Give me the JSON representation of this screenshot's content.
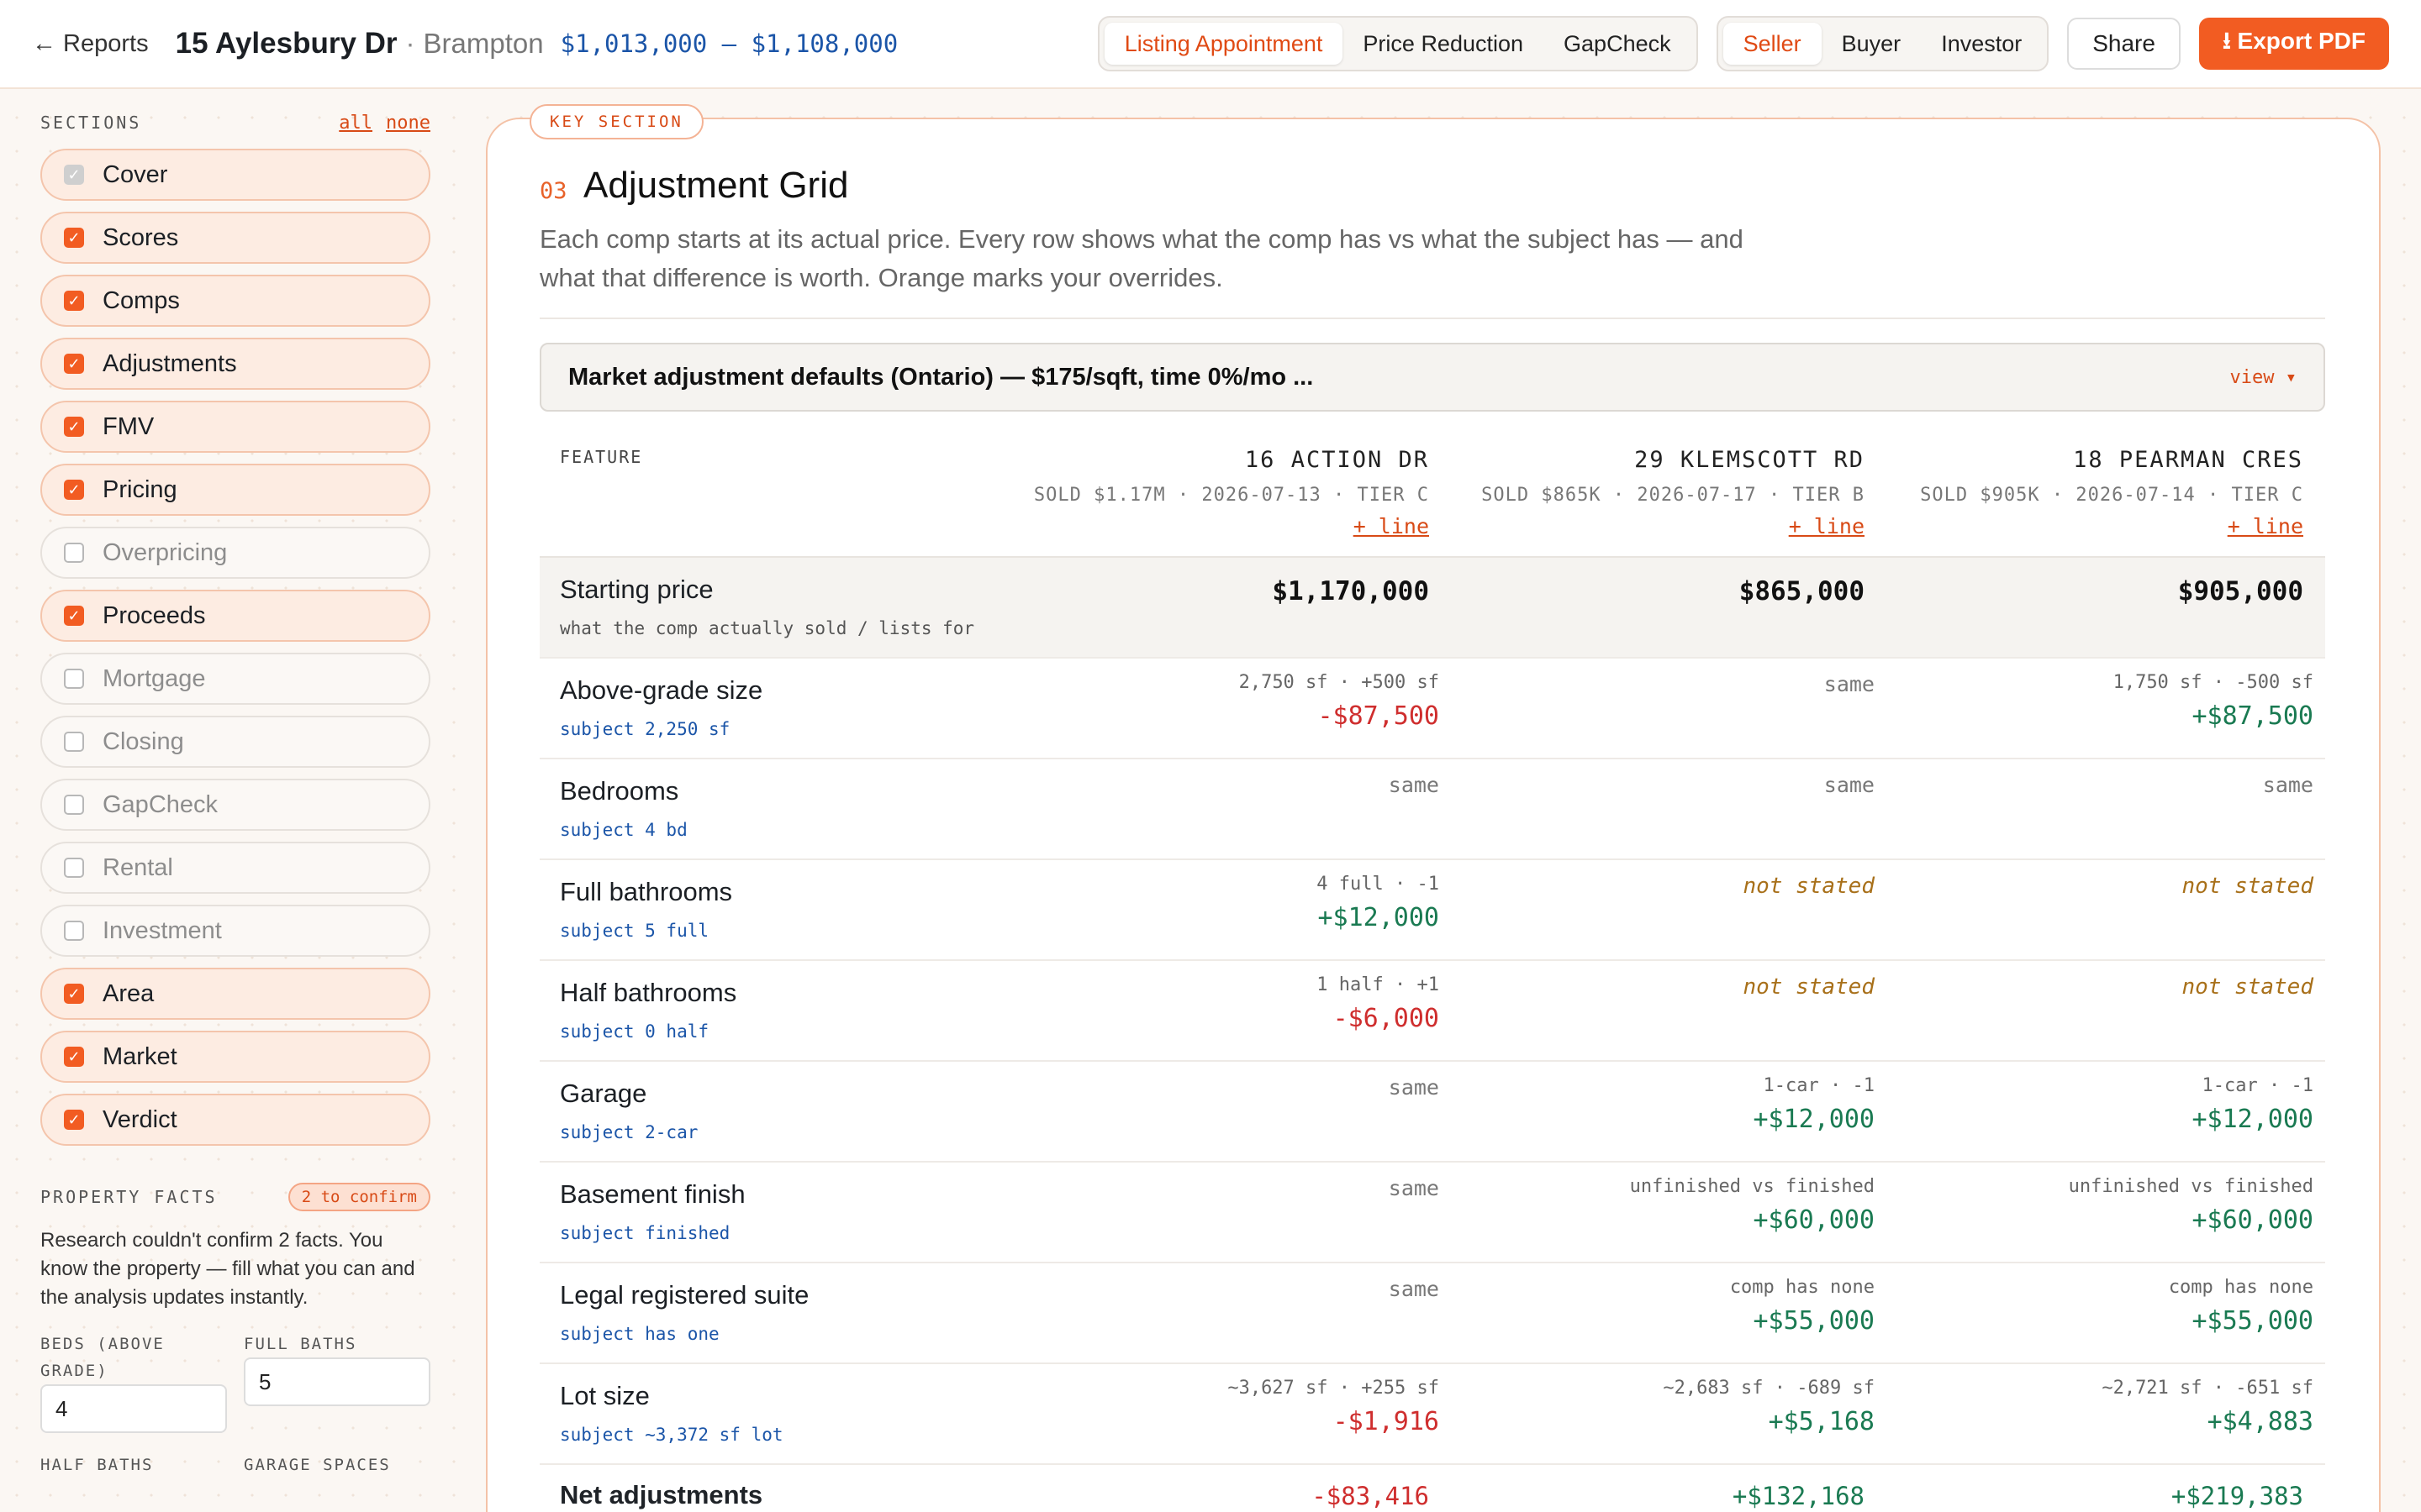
{
  "header": {
    "back_label": "← Reports",
    "address": "15 Aylesbury Dr",
    "separator": "·",
    "city": "Brampton",
    "price_range": "$1,013,000 – $1,108,000",
    "report_types": [
      "Listing Appointment",
      "Price Reduction",
      "GapCheck"
    ],
    "audiences": [
      "Seller",
      "Buyer",
      "Investor"
    ],
    "share_label": "Share",
    "export_label": "⭳ Export PDF"
  },
  "sidebar": {
    "sections_caption": "SECTIONS",
    "all_label": "all",
    "none_label": "none",
    "sections": [
      {
        "label": "Cover",
        "state": "locked"
      },
      {
        "label": "Scores",
        "state": "on"
      },
      {
        "label": "Comps",
        "state": "on"
      },
      {
        "label": "Adjustments",
        "state": "on"
      },
      {
        "label": "FMV",
        "state": "on"
      },
      {
        "label": "Pricing",
        "state": "on"
      },
      {
        "label": "Overpricing",
        "state": "off"
      },
      {
        "label": "Proceeds",
        "state": "on"
      },
      {
        "label": "Mortgage",
        "state": "off"
      },
      {
        "label": "Closing",
        "state": "off"
      },
      {
        "label": "GapCheck",
        "state": "off"
      },
      {
        "label": "Rental",
        "state": "off"
      },
      {
        "label": "Investment",
        "state": "off"
      },
      {
        "label": "Area",
        "state": "on"
      },
      {
        "label": "Market",
        "state": "on"
      },
      {
        "label": "Verdict",
        "state": "on"
      }
    ],
    "facts_caption": "PROPERTY FACTS",
    "facts_badge": "2 to confirm",
    "facts_text": "Research couldn't confirm 2 facts. You know the property — fill what you can and the analysis updates instantly.",
    "fields": [
      {
        "label": "BEDS (ABOVE GRADE)",
        "value": "4"
      },
      {
        "label": "FULL BATHS",
        "value": "5"
      },
      {
        "label": "HALF BATHS",
        "value": ""
      },
      {
        "label": "GARAGE SPACES",
        "value": ""
      }
    ]
  },
  "main": {
    "key_tag": "KEY SECTION",
    "section_number": "03",
    "section_title": "Adjustment Grid",
    "section_desc": "Each comp starts at its actual price. Every row shows what the comp has vs what the subject has — and what that difference is worth. Orange marks your overrides.",
    "defaults_text": "Market adjustment defaults (Ontario) — $175/sqft, time 0%/mo ...",
    "defaults_view": "view ▾",
    "feature_caption": "FEATURE",
    "add_line_label": "+ line",
    "comps": [
      {
        "name": "16 ACTION DR",
        "sub": "SOLD $1.17M · 2026-07-13 · TIER C"
      },
      {
        "name": "29 KLEMSCOTT RD",
        "sub": "SOLD $865K · 2026-07-17 · TIER B"
      },
      {
        "name": "18 PEARMAN CRES",
        "sub": "SOLD $905K · 2026-07-14 · TIER C"
      }
    ],
    "start_row": {
      "label": "Starting price",
      "sub": "what the comp actually sold / lists for",
      "values": [
        "$1,170,000",
        "$865,000",
        "$905,000"
      ]
    },
    "rows": [
      {
        "label": "Above-grade size",
        "subject": "subject 2,250 sf",
        "cells": [
          {
            "note": "2,750 sf · +500 sf",
            "amount": "-$87,500",
            "kind": "neg"
          },
          {
            "same": "same"
          },
          {
            "note": "1,750 sf · -500 sf",
            "amount": "+$87,500",
            "kind": "pos"
          }
        ]
      },
      {
        "label": "Bedrooms",
        "subject": "subject 4 bd",
        "cells": [
          {
            "same": "same"
          },
          {
            "same": "same"
          },
          {
            "same": "same"
          }
        ]
      },
      {
        "label": "Full bathrooms",
        "subject": "subject 5 full",
        "cells": [
          {
            "note": "4 full · -1",
            "amount": "+$12,000",
            "kind": "pos"
          },
          {
            "ns": "not stated"
          },
          {
            "ns": "not stated"
          }
        ]
      },
      {
        "label": "Half bathrooms",
        "subject": "subject 0 half",
        "cells": [
          {
            "note": "1 half · +1",
            "amount": "-$6,000",
            "kind": "neg"
          },
          {
            "ns": "not stated"
          },
          {
            "ns": "not stated"
          }
        ]
      },
      {
        "label": "Garage",
        "subject": "subject 2-car",
        "cells": [
          {
            "same": "same"
          },
          {
            "note": "1-car · -1",
            "amount": "+$12,000",
            "kind": "pos"
          },
          {
            "note": "1-car · -1",
            "amount": "+$12,000",
            "kind": "pos"
          }
        ]
      },
      {
        "label": "Basement finish",
        "subject": "subject finished",
        "cells": [
          {
            "same": "same"
          },
          {
            "note": "unfinished vs finished",
            "amount": "+$60,000",
            "kind": "pos"
          },
          {
            "note": "unfinished vs finished",
            "amount": "+$60,000",
            "kind": "pos"
          }
        ]
      },
      {
        "label": "Legal registered suite",
        "subject": "subject has one",
        "cells": [
          {
            "same": "same"
          },
          {
            "note": "comp has none",
            "amount": "+$55,000",
            "kind": "pos"
          },
          {
            "note": "comp has none",
            "amount": "+$55,000",
            "kind": "pos"
          }
        ]
      },
      {
        "label": "Lot size",
        "subject": "subject ~3,372 sf lot",
        "cells": [
          {
            "note": "~3,627 sf · +255 sf",
            "amount": "-$1,916",
            "kind": "neg"
          },
          {
            "note": "~2,683 sf · -689 sf",
            "amount": "+$5,168",
            "kind": "pos"
          },
          {
            "note": "~2,721 sf · -651 sf",
            "amount": "+$4,883",
            "kind": "pos"
          }
        ]
      }
    ],
    "net_row": {
      "label": "Net adjustments",
      "values": [
        {
          "amount": "-$83,416",
          "kind": "neg"
        },
        {
          "amount": "+$132,168",
          "kind": "pos"
        },
        {
          "amount": "+$219,383",
          "kind": "pos"
        }
      ]
    }
  }
}
